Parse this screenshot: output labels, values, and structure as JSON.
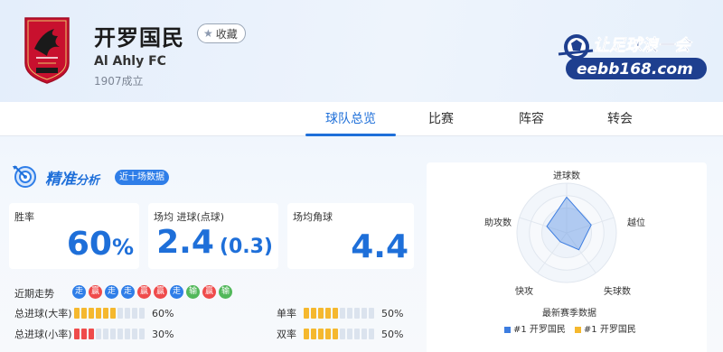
{
  "team": {
    "name": "开罗国民",
    "name_en": "Al Ahly FC",
    "founded": "1907成立",
    "fav_label": "收藏"
  },
  "brand": {
    "top_text": "让足球浪一会",
    "bottom_text": "eebb168.com"
  },
  "tabs": [
    {
      "label": "球队总览",
      "active": true
    },
    {
      "label": "比赛",
      "active": false
    },
    {
      "label": "阵容",
      "active": false
    },
    {
      "label": "转会",
      "active": false
    }
  ],
  "section": {
    "title_main": "精准",
    "title_small": "分析",
    "badge": "近十场数据"
  },
  "stats": [
    {
      "label": "胜率",
      "value": "60",
      "suffix": "%",
      "sub": ""
    },
    {
      "label": "场均 进球(点球)",
      "value": "2.4",
      "suffix": "",
      "sub": "(0.3)"
    },
    {
      "label": "场均角球",
      "value": "4.4",
      "suffix": "",
      "sub": ""
    }
  ],
  "form": {
    "label": "近期走势",
    "results": [
      {
        "text": "走",
        "type": "draw"
      },
      {
        "text": "赢",
        "type": "win"
      },
      {
        "text": "走",
        "type": "draw"
      },
      {
        "text": "走",
        "type": "draw"
      },
      {
        "text": "赢",
        "type": "win"
      },
      {
        "text": "赢",
        "type": "win"
      },
      {
        "text": "走",
        "type": "draw"
      },
      {
        "text": "输",
        "type": "loss"
      },
      {
        "text": "赢",
        "type": "win"
      },
      {
        "text": "输",
        "type": "loss"
      }
    ]
  },
  "bars": [
    {
      "label": "总进球(大率)",
      "pct": "60%",
      "filled": 6,
      "total": 10,
      "color": "#f5b82e"
    },
    {
      "label": "总进球(小率)",
      "pct": "30%",
      "filled": 3,
      "total": 10,
      "color": "#ef4b4b"
    },
    {
      "label": "单率",
      "pct": "50%",
      "filled": 5,
      "total": 10,
      "color": "#f5b82e"
    },
    {
      "label": "双率",
      "pct": "50%",
      "filled": 5,
      "total": 10,
      "color": "#f5b82e"
    }
  ],
  "colors": {
    "accent": "#1e6fd9",
    "win": "#ef4b4b",
    "draw": "#2f7ee8",
    "loss": "#52b85a"
  },
  "radar": {
    "axes": [
      "进球数",
      "越位",
      "失球数",
      "快攻",
      "助攻数"
    ],
    "values": [
      0.72,
      0.52,
      0.42,
      0.22,
      0.42
    ],
    "legend_title": "最新赛季数据",
    "legend": [
      {
        "label": "#1 开罗国民",
        "color": "#3d7de0"
      },
      {
        "label": "#1 开罗国民",
        "color": "#f5b82e"
      }
    ]
  }
}
